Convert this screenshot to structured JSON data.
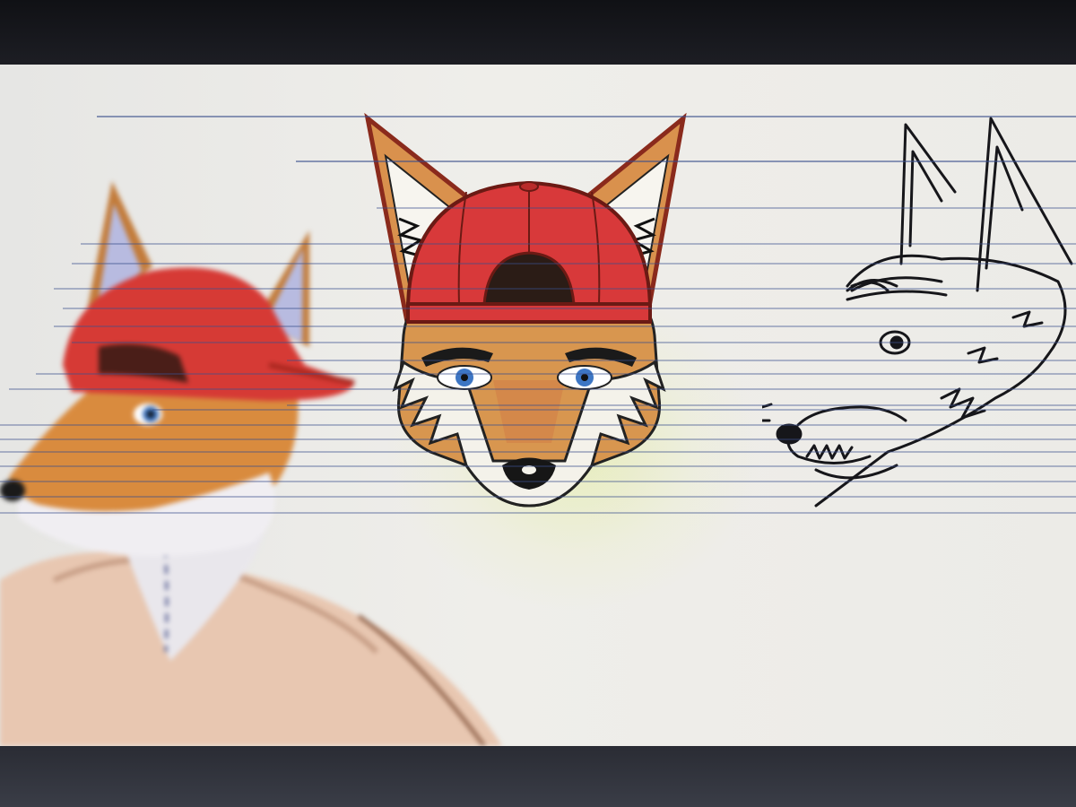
{
  "scene": {
    "photo_subject": "monitor-displaying-fox-character-sketches",
    "colors": {
      "bezel": "#141519",
      "canvas": "#ecebe7",
      "rule_line": "#3a4f8c",
      "cap_red": "#d8393a",
      "fur_orange": "#d8904a",
      "fur_white": "#f2f0ec",
      "eye_blue": "#3d76c4",
      "ink": "#16161a"
    }
  },
  "drawings": [
    {
      "id": "fox-left",
      "style": "colored-blurred",
      "icon": "fox-with-red-cap-torso"
    },
    {
      "id": "fox-center",
      "style": "colored-clean",
      "icon": "fox-head-red-cap"
    },
    {
      "id": "wolf-right",
      "style": "ink-sketch",
      "icon": "fox-head-profile-sketch"
    }
  ]
}
